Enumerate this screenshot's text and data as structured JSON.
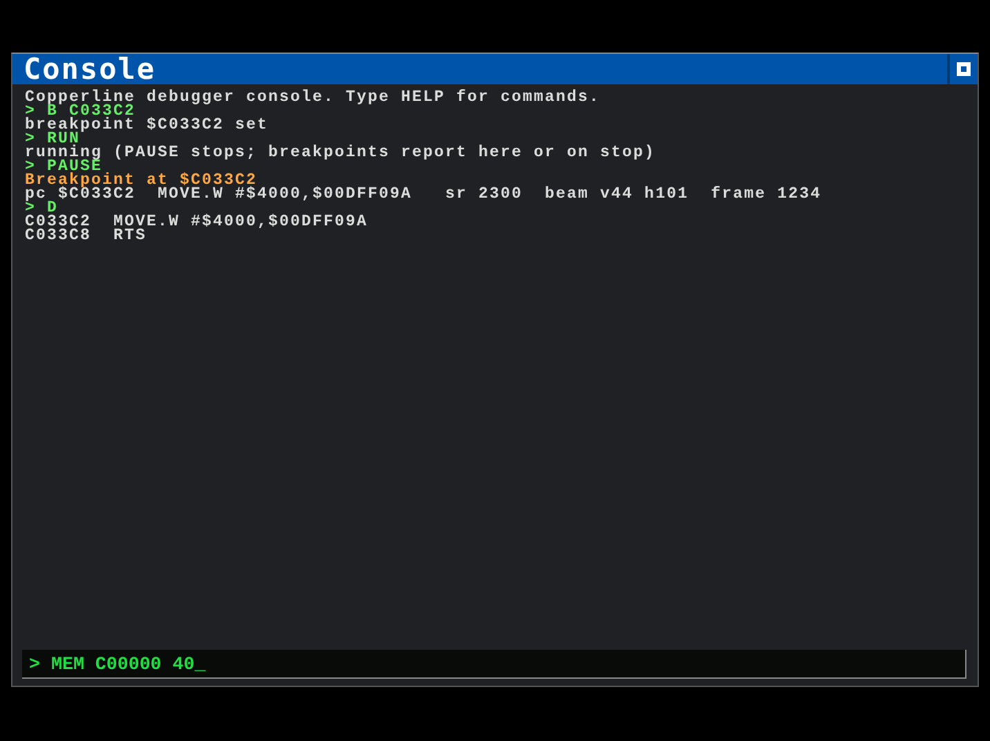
{
  "window": {
    "title": "Console"
  },
  "lines": [
    {
      "kind": "output",
      "text": "Copperline debugger console. Type HELP for commands."
    },
    {
      "kind": "command",
      "text": "> B C033C2"
    },
    {
      "kind": "output",
      "text": "breakpoint $C033C2 set"
    },
    {
      "kind": "command",
      "text": "> RUN"
    },
    {
      "kind": "output",
      "text": "running (PAUSE stops; breakpoints report here or on stop)"
    },
    {
      "kind": "command",
      "text": "> PAUSE"
    },
    {
      "kind": "event",
      "text": "Breakpoint at $C033C2"
    },
    {
      "kind": "output",
      "text": "pc $C033C2  MOVE.W #$4000,$00DFF09A   sr 2300  beam v44 h101  frame 1234"
    },
    {
      "kind": "command",
      "text": "> D"
    },
    {
      "kind": "output",
      "text": "C033C2  MOVE.W #$4000,$00DFF09A"
    },
    {
      "kind": "output",
      "text": "C033C8  RTS"
    }
  ],
  "input": {
    "prompt": ">",
    "value": "MEM C00000 40_"
  }
}
